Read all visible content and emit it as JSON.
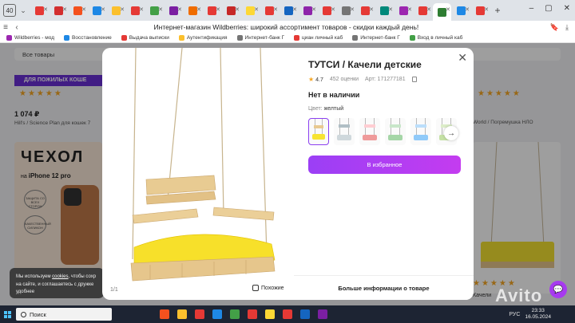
{
  "browser": {
    "tab_count": "40",
    "window_title": "Интернет-магазин Wildberries: широкий ассортимент товаров - скидки каждый день!",
    "tabs": [
      {
        "color": "#e53935"
      },
      {
        "color": "#d32f2f"
      },
      {
        "color": "#f4511e"
      },
      {
        "color": "#1e88e5"
      },
      {
        "color": "#fbc02d"
      },
      {
        "color": "#e53935"
      },
      {
        "color": "#43a047"
      },
      {
        "color": "#7b1fa2"
      },
      {
        "color": "#ef6c00"
      },
      {
        "color": "#e53935"
      },
      {
        "color": "#c62828"
      },
      {
        "color": "#fdd835"
      },
      {
        "color": "#e53935"
      },
      {
        "color": "#1565c0"
      },
      {
        "color": "#8e24aa"
      },
      {
        "color": "#e53935"
      },
      {
        "color": "#757575"
      },
      {
        "color": "#e53935"
      },
      {
        "color": "#00897b"
      },
      {
        "color": "#9c27b0"
      },
      {
        "color": "#e53935"
      },
      {
        "color": "#2e7d32"
      },
      {
        "color": "#1e88e5"
      },
      {
        "color": "#e53935"
      }
    ]
  },
  "bookmarks": [
    {
      "label": "Wildberries - мод",
      "color": "#9c27b0"
    },
    {
      "label": "Восстановление",
      "color": "#1e88e5"
    },
    {
      "label": "Выдача выписки",
      "color": "#e53935"
    },
    {
      "label": "Аутентификация",
      "color": "#fbc02d"
    },
    {
      "label": "Интернет-банк Г",
      "color": "#757575"
    },
    {
      "label": "циан личный каб",
      "color": "#e53935"
    },
    {
      "label": "Интернет-банк Г",
      "color": "#757575"
    },
    {
      "label": "Вход в личный каб",
      "color": "#43a047"
    }
  ],
  "page": {
    "search_text": "Все товары",
    "banner_text": "ДЛЯ ПОЖИЛЫХ КОШЕ",
    "stars": "★★★★★",
    "price": "1 074 ₽",
    "product_name": "Hill's / Science Plan для кошек 7",
    "right_product_name": "World / Погремушка НЛО",
    "case_title": "ЧЕХОЛ",
    "case_sub_prefix": "на",
    "case_sub_model": "iPhone 12 pro",
    "case_badge1": "ЗАЩИТА СО ВСЕХ СТОРОН",
    "case_badge2": "КАЧЕСТВЕННЫЙ СИЛИКОН",
    "right_bottom_text": "Качели",
    "cookie_text_1": "Мы используем",
    "cookie_link": "cookies",
    "cookie_text_2": ", чтобы сохр",
    "cookie_text_3": "согласны с использованием",
    "cookie_text_4": "на сайте, и соглашаетесь с дружке удобнее"
  },
  "modal": {
    "title": "ТУТСИ / Качели детские",
    "rating": "4.7",
    "reviews": "452 оценки",
    "article": "Арт: 171277181",
    "stock": "Нет в наличии",
    "color_label": "Цвет:",
    "color_value": "желтый",
    "favorite_button": "В избранное",
    "more_info": "Больше информации о товаре",
    "image_counter": "1/1",
    "similar_label": "Похожие",
    "thumbs": [
      {
        "seat": "#f7e431",
        "back": "#e8c990"
      },
      {
        "seat": "#cfd8dc",
        "back": "#b0bec5"
      },
      {
        "seat": "#ef9a9a",
        "back": "#ffcdd2"
      },
      {
        "seat": "#a5d6a7",
        "back": "#c8e6c9"
      },
      {
        "seat": "#90caf9",
        "back": "#bbdefb"
      },
      {
        "seat": "#c5e1a5",
        "back": "#dcedc8"
      }
    ]
  },
  "taskbar": {
    "search_placeholder": "Поиск",
    "time": "23:33",
    "date": "16.05.2024",
    "lang": "РУС",
    "apps": [
      "#f4511e",
      "#fbc02d",
      "#e53935",
      "#1e88e5",
      "#43a047",
      "#e53935",
      "#fdd835",
      "#e53935",
      "#1565c0",
      "#7b1fa2"
    ]
  },
  "watermark": "Avito"
}
